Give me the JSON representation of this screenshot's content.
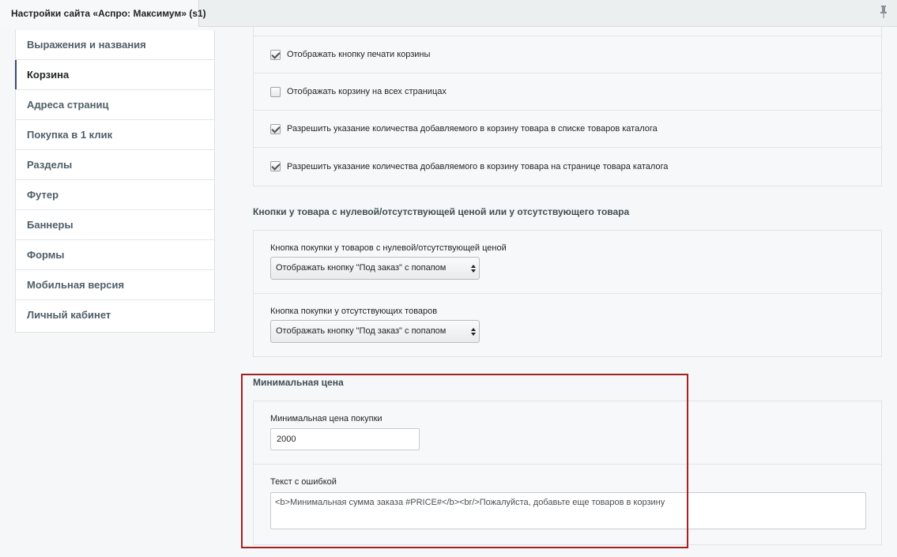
{
  "window": {
    "tab_title": "Настройки сайта «Аспро: Максимум» (s1)",
    "pin_icon": "pin-icon"
  },
  "sidebar": {
    "items": [
      {
        "label": "Выражения и названия",
        "active": false
      },
      {
        "label": "Корзина",
        "active": true
      },
      {
        "label": "Адреса страниц",
        "active": false
      },
      {
        "label": "Покупка в 1 клик",
        "active": false
      },
      {
        "label": "Разделы",
        "active": false
      },
      {
        "label": "Футер",
        "active": false
      },
      {
        "label": "Баннеры",
        "active": false
      },
      {
        "label": "Формы",
        "active": false
      },
      {
        "label": "Мобильная версия",
        "active": false
      },
      {
        "label": "Личный кабинет",
        "active": false
      }
    ]
  },
  "cart_options": [
    {
      "label": "Отображать кнопку печати корзины",
      "checked": true
    },
    {
      "label": "Отображать корзину на всех страницах",
      "checked": false
    },
    {
      "label": "Разрешить указание количества добавляемого в корзину товара в списке товаров каталога",
      "checked": true
    },
    {
      "label": "Разрешить указание количества добавляемого в корзину товара на странице товара каталога",
      "checked": true
    }
  ],
  "zero_price_section": {
    "title": "Кнопки у товара с нулевой/отсутствующей ценой или у отсутствующего товара",
    "fields": [
      {
        "label": "Кнопка покупки у товаров с нулевой/отсутствующей ценой",
        "value": "Отображать кнопку \"Под заказ\" с попапом"
      },
      {
        "label": "Кнопка покупки у отсутствующих товаров",
        "value": "Отображать кнопку \"Под заказ\" с попапом"
      }
    ]
  },
  "min_price_section": {
    "title": "Минимальная цена",
    "min_price_label": "Минимальная цена покупки",
    "min_price_value": "2000",
    "error_text_label": "Текст с ошибкой",
    "error_text_value": "<b>Минимальная сумма заказа #PRICE#</b><br/>Пожалуйста, добавьте еще товаров в корзину"
  },
  "colors": {
    "highlight_border": "#a32226",
    "active_marker": "#3a4a72"
  }
}
